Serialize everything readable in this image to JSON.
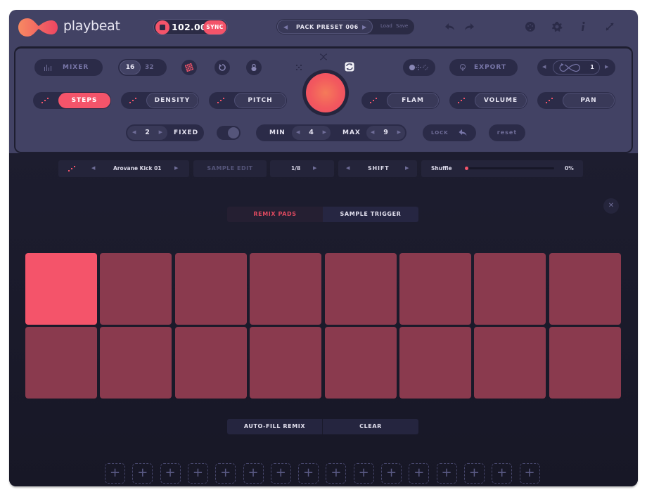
{
  "header": {
    "brand": "playbeat",
    "tempo": {
      "bpm": "102.00",
      "sync_label": "SYNC"
    },
    "preset": {
      "name": "PACK PRESET 006",
      "load_label": "Load",
      "save_label": "Save"
    },
    "icons": [
      "undo-icon",
      "redo-icon",
      "midi-icon",
      "gear-icon",
      "info-icon",
      "resize-icon"
    ]
  },
  "controls": {
    "mixer_label": "MIXER",
    "steps_options": [
      "16",
      "32"
    ],
    "steps_selected": "16",
    "export_label": "EXPORT",
    "loop_count": "1",
    "modes": [
      {
        "label": "STEPS",
        "active": true
      },
      {
        "label": "DENSITY",
        "active": false
      },
      {
        "label": "PITCH",
        "active": false
      },
      {
        "label": "FLAM",
        "active": false
      },
      {
        "label": "VOLUME",
        "active": false
      },
      {
        "label": "PAN",
        "active": false
      }
    ],
    "fixed": {
      "value": "2",
      "label": "FIXED"
    },
    "min": {
      "label": "MIN",
      "value": "4"
    },
    "max": {
      "label": "MAX",
      "value": "9"
    },
    "lock_label": "LOCK",
    "reset_label": "reset"
  },
  "sample_bar": {
    "sample_name": "Arovane Kick 01",
    "sample_edit_label": "SAMPLE EDIT",
    "division": "1/8",
    "shift_label": "SHIFT",
    "shuffle_label": "Shuffle",
    "shuffle_value": "0%",
    "shuffle_fraction": 0
  },
  "tabs": [
    {
      "label": "REMIX PADS",
      "active": true
    },
    {
      "label": "SAMPLE TRIGGER",
      "active": false
    }
  ],
  "pads": {
    "count": 16,
    "active_index": 0
  },
  "actions": {
    "autofill_label": "AUTO-FILL REMIX",
    "clear_label": "CLEAR"
  },
  "slots": {
    "count": 16,
    "symbol": "+"
  },
  "colors": {
    "accent": "#f4546a",
    "pad_idle": "#8a3a4e",
    "panel": "#424264",
    "dark": "#1b1b2c"
  }
}
